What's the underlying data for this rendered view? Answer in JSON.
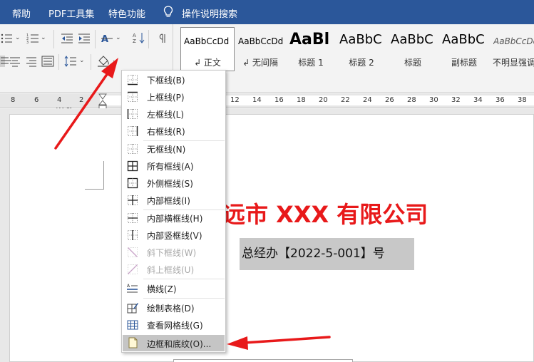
{
  "menubar": {
    "items": [
      "帮助",
      "PDF工具集",
      "特色功能",
      "操作说明搜索"
    ]
  },
  "ribbon": {
    "group_label": "段落",
    "styles": [
      {
        "sample": "AaBbCcDd",
        "name": "↲ 正文"
      },
      {
        "sample": "AaBbCcDd",
        "name": "↲ 无间隔"
      },
      {
        "sample": "AaBl",
        "name": "标题 1"
      },
      {
        "sample": "AaBbC",
        "name": "标题 2"
      },
      {
        "sample": "AaBbC",
        "name": "标题"
      },
      {
        "sample": "AaBbC",
        "name": "副标题"
      },
      {
        "sample": "AaBbCcDd",
        "name": "不明显强调"
      }
    ]
  },
  "ruler": {
    "ticks": [
      "8",
      "6",
      "4",
      "2",
      "12",
      "14",
      "16",
      "18",
      "20",
      "22",
      "24",
      "26",
      "28",
      "30",
      "32",
      "34",
      "36",
      "38"
    ]
  },
  "menu": {
    "items": [
      {
        "label": "下框线(B)",
        "icon": "bottom-border-icon"
      },
      {
        "label": "上框线(P)",
        "icon": "top-border-icon"
      },
      {
        "label": "左框线(L)",
        "icon": "left-border-icon"
      },
      {
        "label": "右框线(R)",
        "icon": "right-border-icon"
      },
      {
        "label": "无框线(N)",
        "icon": "no-border-icon"
      },
      {
        "label": "所有框线(A)",
        "icon": "all-borders-icon"
      },
      {
        "label": "外侧框线(S)",
        "icon": "outside-borders-icon"
      },
      {
        "label": "内部框线(I)",
        "icon": "inside-borders-icon"
      },
      {
        "label": "内部横框线(H)",
        "icon": "inside-horizontal-border-icon"
      },
      {
        "label": "内部竖框线(V)",
        "icon": "inside-vertical-border-icon"
      },
      {
        "label": "斜下框线(W)",
        "icon": "diagonal-down-border-icon"
      },
      {
        "label": "斜上框线(U)",
        "icon": "diagonal-up-border-icon"
      },
      {
        "label": "横线(Z)",
        "icon": "horizontal-line-icon"
      },
      {
        "label": "绘制表格(D)",
        "icon": "draw-table-icon"
      },
      {
        "label": "查看网格线(G)",
        "icon": "view-gridlines-icon"
      },
      {
        "label": "边框和底纹(O)...",
        "icon": "borders-and-shading-icon"
      }
    ]
  },
  "document": {
    "title": "远市 XXX 有限公司",
    "ref": "总经办【2022-5-001】号"
  },
  "colors": {
    "titlebar": "#2b579a",
    "doc_title": "#e8191a",
    "annotation_arrow": "#e8191a"
  }
}
